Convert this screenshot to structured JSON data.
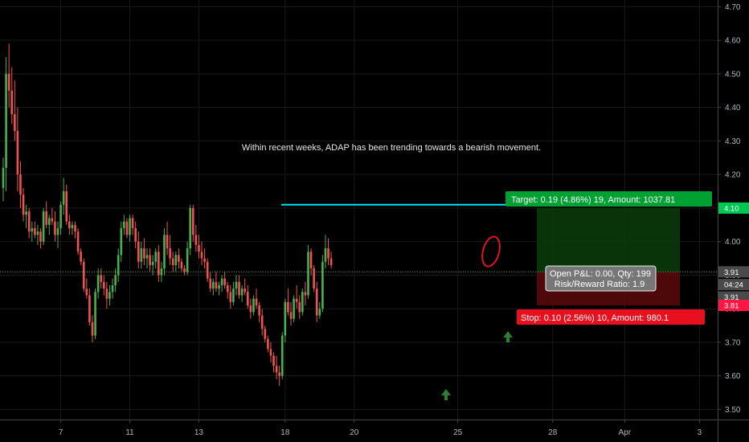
{
  "colors": {
    "background": "#000000",
    "up": "#4caf50",
    "down": "#ef5350",
    "target": "#00c853",
    "stop": "#ff1744",
    "resistance": "#00e5ff",
    "arrow": "#2e7d32",
    "circle": "#e0141e"
  },
  "annotation": "Within recent weeks, ADAP has been trending towards a bearish movement.",
  "target_label": "Target: 0.19 (4.86%) 19, Amount: 1037.81",
  "stop_label": "Stop: 0.10 (2.56%) 10, Amount: 980.1",
  "pnl": {
    "line1": "Open P&L: 0.00, Qty: 199",
    "line2": "Risk/Reward Ratio: 1.9"
  },
  "price_tags": [
    {
      "label": "4.10",
      "value": 4.1,
      "color": "#00c853"
    },
    {
      "label": "3.91",
      "value": 3.91,
      "color": "#4a4a4a"
    },
    {
      "label": "04:24",
      "value": 3.872,
      "color": "#4a4a4a"
    },
    {
      "label": "3.91",
      "value": 3.835,
      "color": "#4a4a4a"
    },
    {
      "label": "3.81",
      "value": 3.81,
      "color": "#ff1744"
    }
  ],
  "chart_data": {
    "type": "candlestick",
    "ylim": [
      3.47,
      4.72
    ],
    "y_ticks": [
      3.5,
      3.6,
      3.7,
      3.8,
      3.9,
      4.0,
      4.1,
      4.2,
      4.3,
      4.4,
      4.5,
      4.6,
      4.7
    ],
    "y_tick_labels": [
      "3.50",
      "3.60",
      "3.70",
      "3.80",
      "3.90",
      "4.00",
      "4.10",
      "4.20",
      "4.30",
      "4.40",
      "4.50",
      "4.60",
      "4.70"
    ],
    "x_ticks": [
      {
        "label": "7",
        "index": 20
      },
      {
        "label": "11",
        "index": 44
      },
      {
        "label": "13",
        "index": 68
      },
      {
        "label": "18",
        "index": 98
      },
      {
        "label": "20",
        "index": 122
      },
      {
        "label": "25",
        "index": 158
      },
      {
        "label": "28",
        "index": 191
      },
      {
        "label": "Apr",
        "index": 216
      },
      {
        "label": "3",
        "index": 242
      }
    ],
    "last_price": 3.91,
    "resistance_level": 4.11,
    "target_level": 4.1,
    "entry_level": 3.91,
    "stop_level": 3.81,
    "candles": [
      [
        4.16,
        4.25,
        4.12,
        4.22
      ],
      [
        4.22,
        4.55,
        4.15,
        4.5
      ],
      [
        4.5,
        4.59,
        4.4,
        4.45
      ],
      [
        4.45,
        4.52,
        4.35,
        4.38
      ],
      [
        4.38,
        4.48,
        4.3,
        4.33
      ],
      [
        4.33,
        4.4,
        4.15,
        4.2
      ],
      [
        4.2,
        4.24,
        4.1,
        4.14
      ],
      [
        4.14,
        4.16,
        4.06,
        4.08
      ],
      [
        4.08,
        4.11,
        4.04,
        4.09
      ],
      [
        4.09,
        4.1,
        4.01,
        4.03
      ],
      [
        4.03,
        4.06,
        4.0,
        4.04
      ],
      [
        4.04,
        4.06,
        4.01,
        4.02
      ],
      [
        4.02,
        4.05,
        3.99,
        4.03
      ],
      [
        4.03,
        4.04,
        3.98,
        4.0
      ],
      [
        4.0,
        4.1,
        3.99,
        4.09
      ],
      [
        4.09,
        4.12,
        4.04,
        4.05
      ],
      [
        4.05,
        4.08,
        4.02,
        4.07
      ],
      [
        4.07,
        4.1,
        4.05,
        4.06
      ],
      [
        4.06,
        4.09,
        4.0,
        4.02
      ],
      [
        4.02,
        4.06,
        3.98,
        4.04
      ],
      [
        4.04,
        4.12,
        4.02,
        4.11
      ],
      [
        4.11,
        4.19,
        4.08,
        4.15
      ],
      [
        4.15,
        4.17,
        4.05,
        4.06
      ],
      [
        4.06,
        4.08,
        4.02,
        4.04
      ],
      [
        4.04,
        4.06,
        4.02,
        4.05
      ],
      [
        4.05,
        4.06,
        4.01,
        4.03
      ],
      [
        4.03,
        4.04,
        3.96,
        3.97
      ],
      [
        3.97,
        3.98,
        3.93,
        3.94
      ],
      [
        3.94,
        3.95,
        3.85,
        3.86
      ],
      [
        3.86,
        3.89,
        3.83,
        3.84
      ],
      [
        3.84,
        3.86,
        3.75,
        3.76
      ],
      [
        3.76,
        3.78,
        3.7,
        3.72
      ],
      [
        3.72,
        3.86,
        3.71,
        3.85
      ],
      [
        3.85,
        3.92,
        3.83,
        3.9
      ],
      [
        3.9,
        3.92,
        3.86,
        3.88
      ],
      [
        3.88,
        3.9,
        3.84,
        3.86
      ],
      [
        3.86,
        3.88,
        3.8,
        3.83
      ],
      [
        3.83,
        3.87,
        3.81,
        3.85
      ],
      [
        3.85,
        3.89,
        3.83,
        3.87
      ],
      [
        3.87,
        3.92,
        3.85,
        3.9
      ],
      [
        3.9,
        3.98,
        3.88,
        3.96
      ],
      [
        3.96,
        4.06,
        3.94,
        4.04
      ],
      [
        4.04,
        4.08,
        4.02,
        4.06
      ],
      [
        4.06,
        4.07,
        4.01,
        4.02
      ],
      [
        4.02,
        4.08,
        4.0,
        4.07
      ],
      [
        4.07,
        4.08,
        4.02,
        4.04
      ],
      [
        4.04,
        4.06,
        3.98,
        4.0
      ],
      [
        4.0,
        4.03,
        3.92,
        3.94
      ],
      [
        3.94,
        4.0,
        3.92,
        3.98
      ],
      [
        3.98,
        4.01,
        3.93,
        3.95
      ],
      [
        3.95,
        3.98,
        3.92,
        3.96
      ],
      [
        3.96,
        3.98,
        3.91,
        3.93
      ],
      [
        3.93,
        3.96,
        3.9,
        3.94
      ],
      [
        3.94,
        3.98,
        3.92,
        3.97
      ],
      [
        3.97,
        3.99,
        3.88,
        3.9
      ],
      [
        3.9,
        3.94,
        3.88,
        3.92
      ],
      [
        3.92,
        4.04,
        3.9,
        4.02
      ],
      [
        4.02,
        4.06,
        3.96,
        3.98
      ],
      [
        3.98,
        4.02,
        3.93,
        3.95
      ],
      [
        3.95,
        3.97,
        3.91,
        3.93
      ],
      [
        3.93,
        3.97,
        3.91,
        3.96
      ],
      [
        3.96,
        3.98,
        3.92,
        3.94
      ],
      [
        3.94,
        3.95,
        3.91,
        3.92
      ],
      [
        3.92,
        3.93,
        3.9,
        3.91
      ],
      [
        3.91,
        4.0,
        3.9,
        3.98
      ],
      [
        3.98,
        4.11,
        3.96,
        4.1
      ],
      [
        4.1,
        4.11,
        4.0,
        4.02
      ],
      [
        4.02,
        4.05,
        3.97,
        3.99
      ],
      [
        3.99,
        4.02,
        3.95,
        3.97
      ],
      [
        3.97,
        4.0,
        3.93,
        3.95
      ],
      [
        3.95,
        3.98,
        3.92,
        3.94
      ],
      [
        3.94,
        3.95,
        3.88,
        3.89
      ],
      [
        3.89,
        3.91,
        3.85,
        3.86
      ],
      [
        3.86,
        3.89,
        3.84,
        3.88
      ],
      [
        3.88,
        3.91,
        3.85,
        3.86
      ],
      [
        3.86,
        3.88,
        3.84,
        3.87
      ],
      [
        3.87,
        3.9,
        3.85,
        3.89
      ],
      [
        3.89,
        3.91,
        3.86,
        3.87
      ],
      [
        3.87,
        3.88,
        3.83,
        3.85
      ],
      [
        3.85,
        3.87,
        3.8,
        3.82
      ],
      [
        3.82,
        3.88,
        3.81,
        3.86
      ],
      [
        3.86,
        3.9,
        3.84,
        3.88
      ],
      [
        3.88,
        3.9,
        3.83,
        3.84
      ],
      [
        3.84,
        3.87,
        3.82,
        3.86
      ],
      [
        3.86,
        3.89,
        3.84,
        3.85
      ],
      [
        3.85,
        3.87,
        3.8,
        3.81
      ],
      [
        3.81,
        3.83,
        3.77,
        3.79
      ],
      [
        3.79,
        3.84,
        3.78,
        3.83
      ],
      [
        3.83,
        3.86,
        3.8,
        3.81
      ],
      [
        3.81,
        3.82,
        3.76,
        3.78
      ],
      [
        3.78,
        3.8,
        3.72,
        3.74
      ],
      [
        3.74,
        3.75,
        3.7,
        3.71
      ],
      [
        3.71,
        3.72,
        3.67,
        3.68
      ],
      [
        3.68,
        3.7,
        3.64,
        3.66
      ],
      [
        3.66,
        3.67,
        3.61,
        3.63
      ],
      [
        3.63,
        3.66,
        3.59,
        3.61
      ],
      [
        3.61,
        3.63,
        3.57,
        3.6
      ],
      [
        3.6,
        3.73,
        3.59,
        3.72
      ],
      [
        3.72,
        3.83,
        3.7,
        3.82
      ],
      [
        3.82,
        3.86,
        3.78,
        3.79
      ],
      [
        3.79,
        3.82,
        3.75,
        3.77
      ],
      [
        3.77,
        3.84,
        3.76,
        3.83
      ],
      [
        3.83,
        3.87,
        3.8,
        3.82
      ],
      [
        3.82,
        3.84,
        3.77,
        3.79
      ],
      [
        3.79,
        3.86,
        3.78,
        3.85
      ],
      [
        3.85,
        3.88,
        3.81,
        3.84
      ],
      [
        3.84,
        3.99,
        3.83,
        3.97
      ],
      [
        3.97,
        3.98,
        3.9,
        3.92
      ],
      [
        3.92,
        3.93,
        3.85,
        3.86
      ],
      [
        3.86,
        3.88,
        3.76,
        3.78
      ],
      [
        3.78,
        3.82,
        3.77,
        3.8
      ],
      [
        3.8,
        3.96,
        3.79,
        3.94
      ],
      [
        3.94,
        4.02,
        3.92,
        3.98
      ],
      [
        3.98,
        4.01,
        3.93,
        3.95
      ],
      [
        3.95,
        3.97,
        3.92,
        3.93
      ]
    ]
  }
}
